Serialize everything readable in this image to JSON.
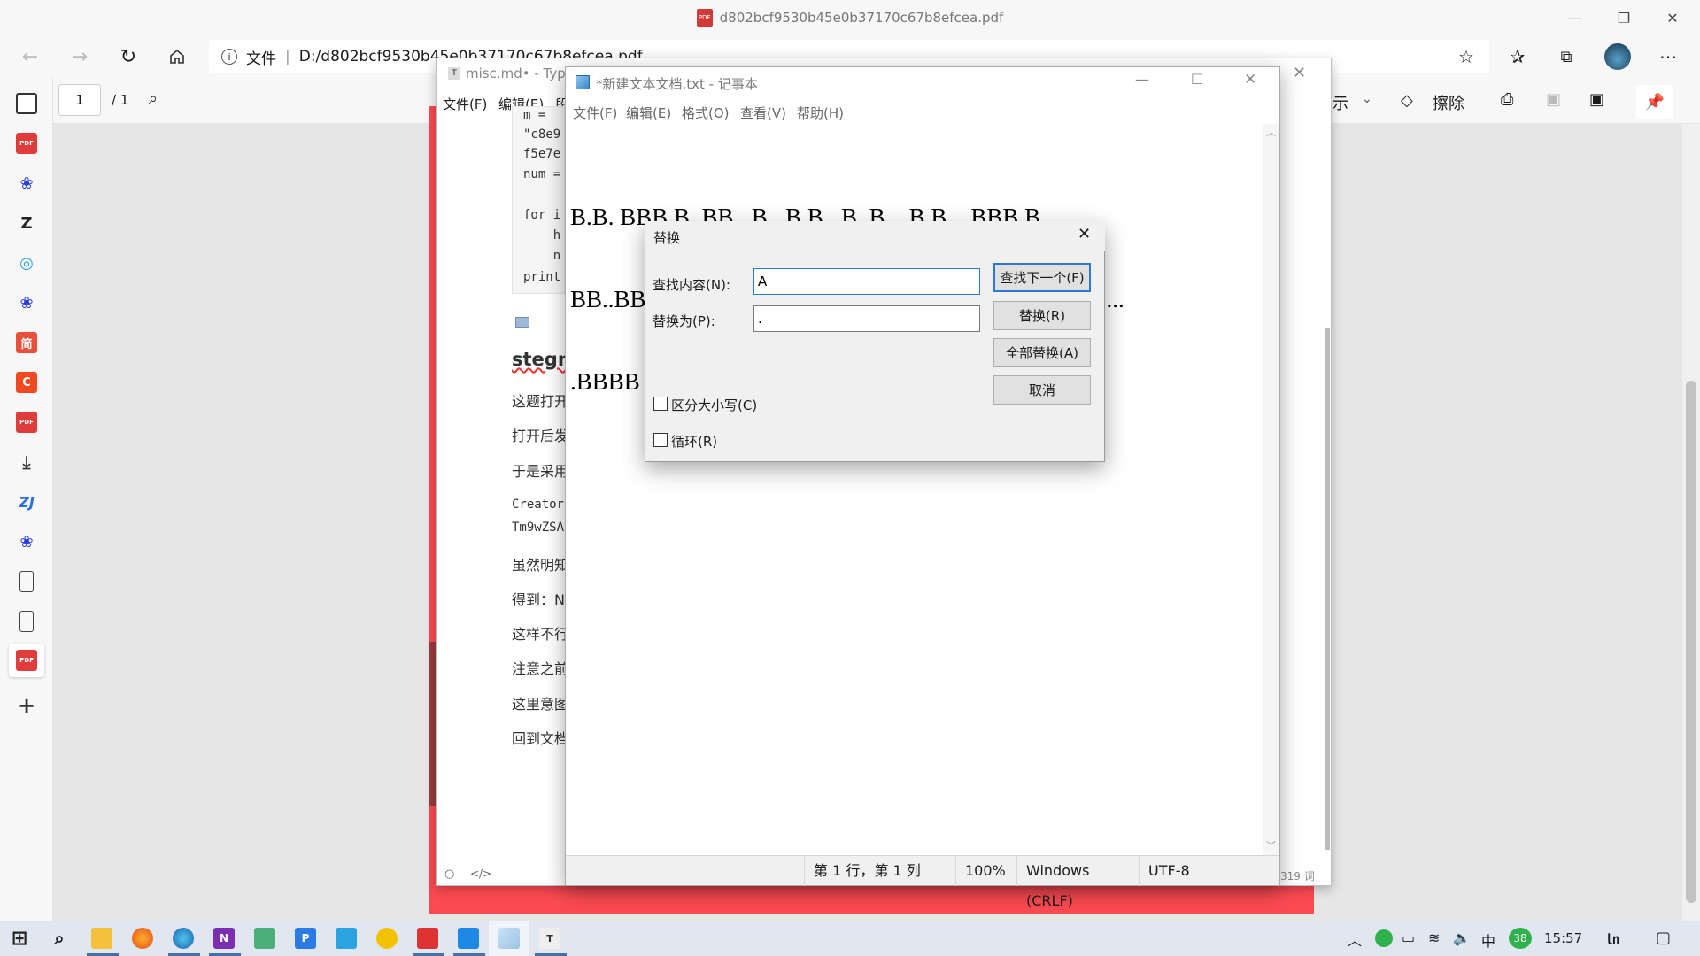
{
  "edge": {
    "title": "d802bcf9530b45e0b37170c67b8efcea.pdf",
    "address_prefix": "文件",
    "address_url": "D:/d802bcf9530b45e0b37170c67b8efcea.pdf",
    "page_current": "1",
    "page_total": "/ 1",
    "erase_label": "擦除",
    "show_label_partial": "示"
  },
  "typora": {
    "title": "misc.md• - Typo",
    "menu": [
      "文件(F)",
      "编辑(E)",
      "段"
    ],
    "code_lines": [
      "m =",
      "\"c8e9",
      "f5e7e",
      "num =",
      "",
      "for i",
      "    h",
      "    n",
      "print"
    ],
    "heading": "stegna",
    "paragraphs": [
      "这题打开",
      "打开后发",
      "于是采用"
    ],
    "mono_lines": [
      "Creator",
      "Tm9wZSA"
    ],
    "paragraphs2": [
      "虽然明知",
      "得到：N",
      "这样不行",
      "注意之前",
      "这里意图",
      "回到文档"
    ],
    "word_count": "319 词"
  },
  "notepad": {
    "title": "*新建文本文档.txt - 记事本",
    "menu": [
      "文件(F)",
      "编辑(E)",
      "格式(O)",
      "查看(V)",
      "帮助(H)"
    ],
    "lines": [
      "B.B. BBB B. BB. .B. .B B ..B .B.. .B B .. BBB B. ...",
      "BB..BB ..B. .B.. .B BB. BBB... .BBBB B. ...B .BBBB .....",
      ".BBBB B     B        BB BB     BB                 B BB. ...BB"
    ],
    "status": {
      "position": "第 1 行，第 1 列",
      "zoom": "100%",
      "eol": "Windows (CRLF)",
      "encoding": "UTF-8"
    }
  },
  "dialog": {
    "title": "替换",
    "find_label": "查找内容(N):",
    "find_value": "A",
    "replace_label": "替换为(P):",
    "replace_value": ".",
    "btn_find_next": "查找下一个(F)",
    "btn_replace": "替换(R)",
    "btn_replace_all": "全部替换(A)",
    "btn_cancel": "取消",
    "match_case": "区分大小写(C)",
    "wrap": "循环(R)"
  },
  "taskbar": {
    "clock": "15:57",
    "ime": "中",
    "badge": "38"
  },
  "colors": {
    "red_page": "#fb4a52",
    "edge_bg": "#f7f7f7",
    "taskbar": "#e1e7f0"
  }
}
